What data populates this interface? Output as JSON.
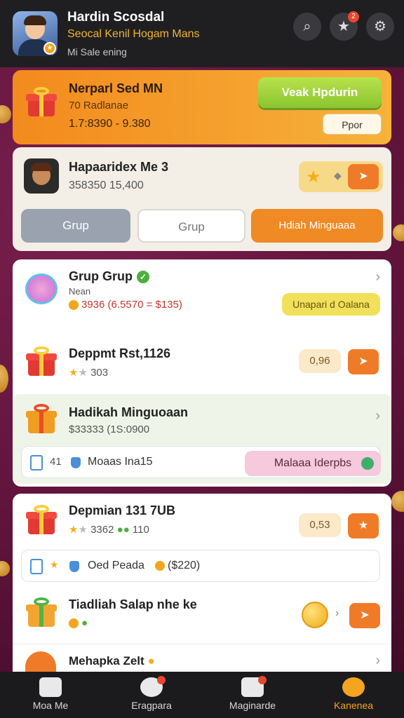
{
  "header": {
    "name": "Hardin Scosdal",
    "subtitle": "Seocal Kenil Hogam Mans",
    "status": "Mi Sale ening",
    "notif_count": "2"
  },
  "promo": {
    "title": "Nerparl Sed MN",
    "subtitle": "70 Radlanae",
    "range": "1.7:8390 - 9.380",
    "primary_btn": "Veak Hpdurin",
    "secondary_btn": "Ppor"
  },
  "profile": {
    "title": "Hapaaridex Me 3",
    "values": "358350 15,400",
    "tabs": [
      "Grup",
      "Grup",
      "Hdiah Minguaaa"
    ]
  },
  "items": [
    {
      "title": "Grup Grup",
      "sub": "Nean",
      "amount": "3936 (6.5570 = $135)",
      "action": "Unapari d Oalana"
    },
    {
      "title": "Deppmt Rst,1126",
      "sub": "303",
      "value": "0,96"
    },
    {
      "title": "Hadikah Minguoaan",
      "sub": "$33333 (1S:0900",
      "detail_num": "41",
      "detail_label": "Moaas Ina15",
      "detail_btn": "Malaaa Iderpbs"
    },
    {
      "title": "Depmian 131 7UB",
      "sub": "3362",
      "sub2": "110",
      "value": "0,53",
      "detail_label": "Oed Peada",
      "detail_amount": "($220)"
    },
    {
      "title": "Tiadliah Salap nhe ke",
      "sub": ""
    },
    {
      "title": "Mehapka Zelt"
    }
  ],
  "nav": {
    "items": [
      "Moa Me",
      "Eragpara",
      "Maginarde",
      "Kanenea"
    ],
    "active_index": 3
  },
  "colors": {
    "accent": "#ef8a24",
    "header_bg": "#1f1f22",
    "nav_active": "#f3a51f"
  }
}
